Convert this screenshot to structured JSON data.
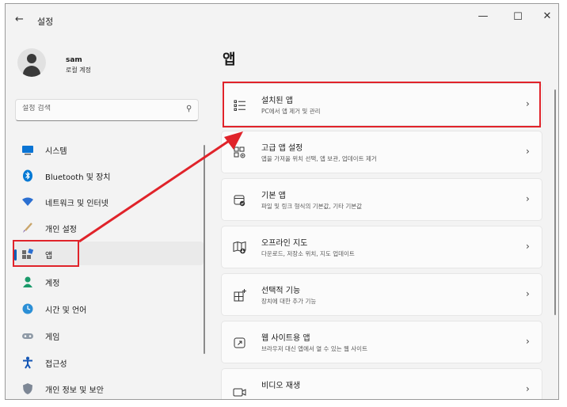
{
  "window": {
    "back": "←",
    "title": "설정",
    "minimize": "—",
    "maximize": "☐",
    "close": "✕"
  },
  "user": {
    "name": "sam",
    "account_type": "로컬 계정"
  },
  "search": {
    "placeholder": "설정 검색"
  },
  "sidebar": {
    "items": [
      {
        "label": "시스템",
        "icon": "system-icon"
      },
      {
        "label": "Bluetooth 및 장치",
        "icon": "bluetooth-icon"
      },
      {
        "label": "네트워크 및 인터넷",
        "icon": "network-icon"
      },
      {
        "label": "개인 설정",
        "icon": "personalization-icon"
      },
      {
        "label": "앱",
        "icon": "apps-icon",
        "selected": true
      },
      {
        "label": "계정",
        "icon": "account-icon"
      },
      {
        "label": "시간 및 언어",
        "icon": "time-language-icon"
      },
      {
        "label": "게임",
        "icon": "gaming-icon"
      },
      {
        "label": "접근성",
        "icon": "accessibility-icon"
      },
      {
        "label": "개인 정보 및 보안",
        "icon": "privacy-icon"
      }
    ]
  },
  "main": {
    "title": "앱",
    "cards": [
      {
        "title": "설치된 앱",
        "desc": "PC에서 앱 제거 및 관리",
        "icon": "installed-apps-icon"
      },
      {
        "title": "고급 앱 설정",
        "desc": "앱을 가져올 위치 선택, 앱 보관, 업데이트 제거",
        "icon": "advanced-apps-icon"
      },
      {
        "title": "기본 앱",
        "desc": "파일 및 링크 형식의 기본값, 기타 기본값",
        "icon": "default-apps-icon"
      },
      {
        "title": "오프라인 지도",
        "desc": "다운로드, 저장소 위치, 지도 업데이트",
        "icon": "offline-maps-icon"
      },
      {
        "title": "선택적 기능",
        "desc": "장치에 대한 추가 기능",
        "icon": "optional-features-icon"
      },
      {
        "title": "웹 사이트용 앱",
        "desc": "브라우저 대신 앱에서 열 수 있는 웹 사이트",
        "icon": "apps-for-websites-icon"
      },
      {
        "title": "비디오 재생",
        "desc": "",
        "icon": "video-playback-icon"
      }
    ]
  },
  "colors": {
    "accent": "#005fb8",
    "highlight": "#e0232a",
    "background": "#f3f3f3",
    "card": "#fbfbfb"
  }
}
